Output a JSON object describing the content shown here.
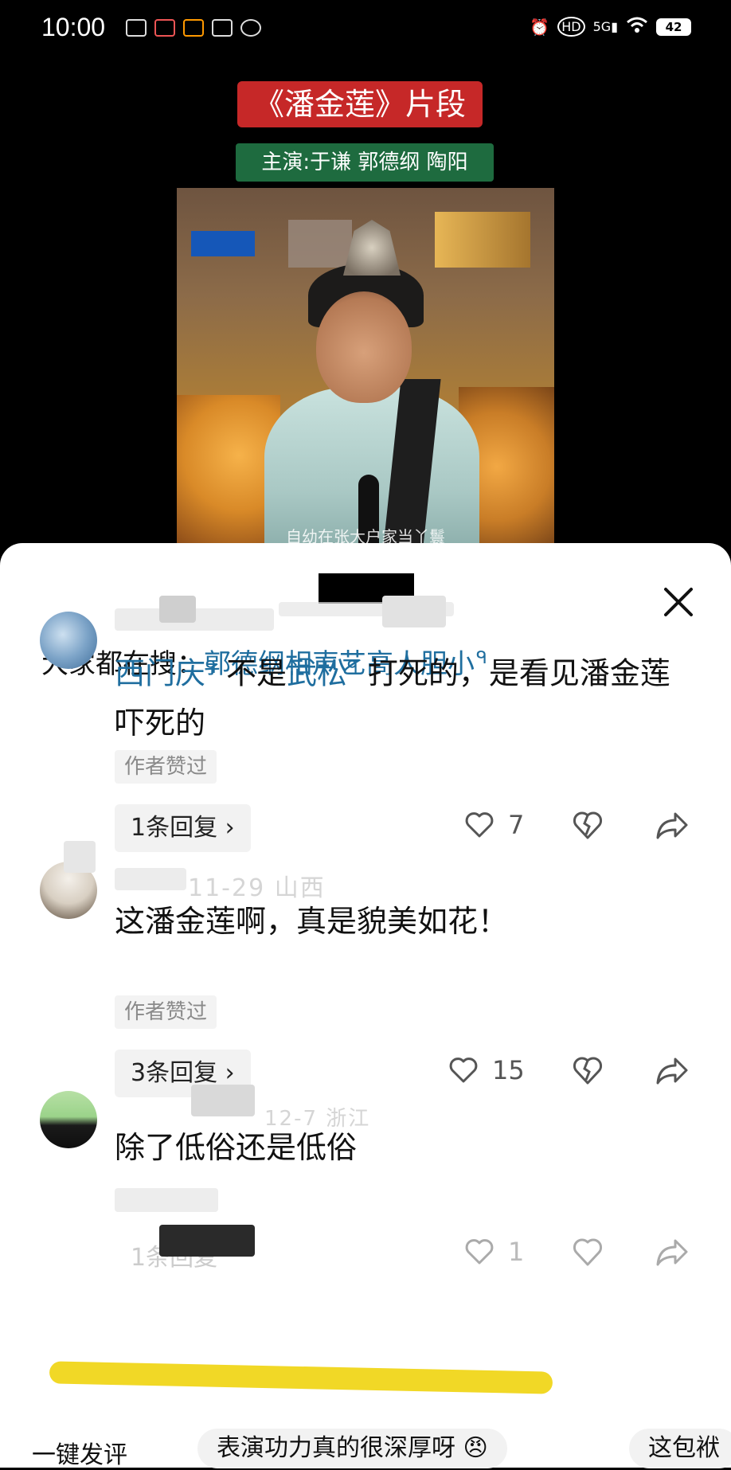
{
  "status_bar": {
    "time": "10:00",
    "app_icons": [
      "vivo-app-icon",
      "app-icon-2",
      "weibo-icon",
      "app-icon-4",
      "link-icon"
    ],
    "indicators": [
      "alarm-icon",
      "hd-icon",
      "5g-signal-icon",
      "wifi-icon"
    ],
    "battery": "42"
  },
  "video": {
    "title": "《潘金莲》片段",
    "cast": "主演:于谦 郭德纲 陶阳",
    "subtitle": "自幼在张大户家当丫鬟"
  },
  "sheet": {
    "hot_search_label": "大家都在搜：",
    "hot_search_query": "郭德纲相声艺高人胆小"
  },
  "comments": [
    {
      "text_parts": [
        "西门庆",
        "不是",
        "武松",
        "打死的，是看见潘金莲吓死的"
      ],
      "badge": "作者赞过",
      "replies": "1条回复",
      "likes": "7"
    },
    {
      "meta_ghost": "11-29 山西",
      "text": "这潘金莲啊，真是貌美如花！",
      "badge": "作者赞过",
      "replies": "3条回复",
      "likes": "15"
    },
    {
      "meta_ghost": "12-7 浙江",
      "text": "除了低俗还是低俗",
      "replies": "条回复",
      "likes": "1"
    }
  ],
  "bottom": {
    "quick_label": "一键发评",
    "chip_1": "表演功力真的很深厚呀",
    "chip_2": "这包袱"
  },
  "colors": {
    "link": "#1f6e9f",
    "title_bg": "#c62828",
    "cast_bg": "#1e6b3f",
    "highlight": "#f0d61a"
  }
}
